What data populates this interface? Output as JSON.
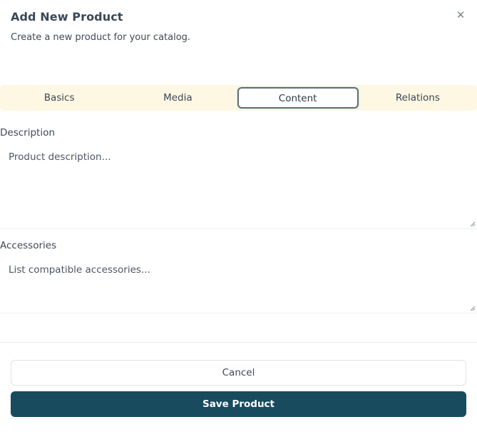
{
  "dialog": {
    "title": "Add New Product",
    "subtitle": "Create a new product for your catalog.",
    "close_icon": "close-icon"
  },
  "tabs": [
    {
      "label": "Basics",
      "active": false
    },
    {
      "label": "Media",
      "active": false
    },
    {
      "label": "Content",
      "active": true
    },
    {
      "label": "Relations",
      "active": false
    }
  ],
  "fields": {
    "description": {
      "label": "Description",
      "value": "",
      "placeholder": "Product description..."
    },
    "accessories": {
      "label": "Accessories",
      "value": "",
      "placeholder": "List compatible accessories..."
    }
  },
  "footer": {
    "cancel_label": "Cancel",
    "save_label": "Save Product"
  },
  "colors": {
    "accent": "#184b5e",
    "tabs_background": "#fdf7e3"
  }
}
